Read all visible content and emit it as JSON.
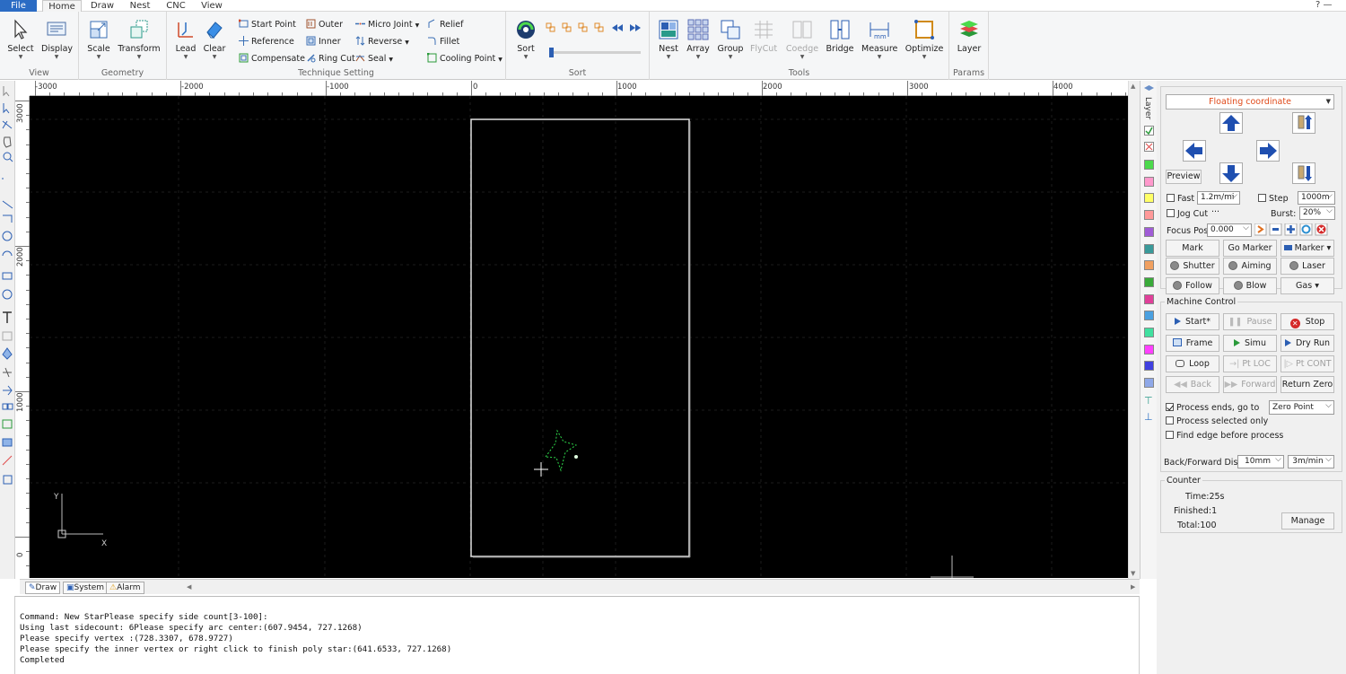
{
  "menubar": {
    "tabs": [
      {
        "label": "File"
      },
      {
        "label": "Home"
      },
      {
        "label": "Draw"
      },
      {
        "label": "Nest"
      },
      {
        "label": "CNC"
      },
      {
        "label": "View"
      }
    ],
    "window_controls": "? —"
  },
  "ribbon": {
    "groups": {
      "view": "View",
      "geometry": "Geometry",
      "technique": "Technique Setting",
      "sort": "Sort",
      "tools": "Tools",
      "params": "Params"
    },
    "buttons": {
      "select": "Select",
      "display": "Display",
      "scale": "Scale",
      "transform": "Transform",
      "lead": "Lead",
      "clear": "Clear",
      "start_point": "Start Point",
      "reference": "Reference",
      "compensate": "Compensate",
      "outer": "Outer",
      "inner": "Inner",
      "ring_cut": "Ring Cut",
      "micro_joint": "Micro Joint",
      "reverse": "Reverse",
      "seal": "Seal",
      "relief": "Relief",
      "fillet": "Fillet",
      "cooling_point": "Cooling Point",
      "sort": "Sort",
      "nest": "Nest",
      "array": "Array",
      "group": "Group",
      "flycut": "FlyCut",
      "coedge": "Coedge",
      "bridge": "Bridge",
      "measure": "Measure",
      "optimize": "Optimize",
      "layer": "Layer"
    }
  },
  "ruler": {
    "h_labels": [
      "-3000",
      "-2000",
      "-1000",
      "0",
      "1000",
      "2000",
      "3000",
      "4000"
    ],
    "v_labels": [
      "3000",
      "2000",
      "1000",
      "0"
    ]
  },
  "canvas": {
    "axis_y": "Y",
    "axis_x": "X"
  },
  "layer": {
    "title": "Layer",
    "colors": [
      "#4cd94c",
      "#ff99cc",
      "#ffff66",
      "#ff9999",
      "#a05cd6",
      "#3a9a9a",
      "#f0a060",
      "#3aaa3a",
      "#e0409a",
      "#4aa0e0",
      "#40e0a0",
      "#ff40ff",
      "#4040e0",
      "#8fa8e8"
    ]
  },
  "control": {
    "coordinate_mode": "Floating coordinate",
    "preview": "Preview",
    "fast_label": "Fast",
    "fast_value": "1.2m/mi",
    "step_label": "Step",
    "step_value": "1000m",
    "jog_cut": "Jog Cut",
    "jog_dots": "···",
    "burst_label": "Burst:",
    "burst_value": "20%",
    "focus_label": "Focus Pos",
    "focus_value": "0.000",
    "mark": "Mark",
    "go_marker": "Go Marker",
    "marker": "Marker",
    "shutter": "Shutter",
    "aiming": "Aiming",
    "laser": "Laser",
    "follow": "Follow",
    "blow": "Blow",
    "gas": "Gas"
  },
  "machine": {
    "title": "Machine Control",
    "start": "Start*",
    "pause": "Pause",
    "stop": "Stop",
    "frame": "Frame",
    "simu": "Simu",
    "dry_run": "Dry Run",
    "loop": "Loop",
    "pt_loc": "Pt LOC",
    "pt_cont": "Pt CONT",
    "back": "Back",
    "forward": "Forward",
    "return_zero": "Return Zero",
    "process_ends": "Process ends, go to",
    "process_ends_value": "Zero Point",
    "process_selected": "Process selected only",
    "find_edge": "Find edge before process",
    "bf_label": "Back/Forward Dis:",
    "bf_dist": "10mm",
    "bf_speed": "3m/min"
  },
  "counter": {
    "title": "Counter",
    "time": "Time:25s",
    "finished": "Finished:1",
    "total": "Total:100",
    "manage": "Manage"
  },
  "bottom_tabs": [
    {
      "label": "Draw"
    },
    {
      "label": "System"
    },
    {
      "label": "Alarm"
    }
  ],
  "command_log": [
    "Command: New StarPlease specify side count[3-100]:",
    "Using last sidecount: 6Please specify arc center:(607.9454, 727.1268)",
    "Please specify vertex :(728.3307, 678.9727)",
    "Please specify the inner vertex or right click to finish poly star:(641.6533, 727.1268)",
    "Completed"
  ]
}
